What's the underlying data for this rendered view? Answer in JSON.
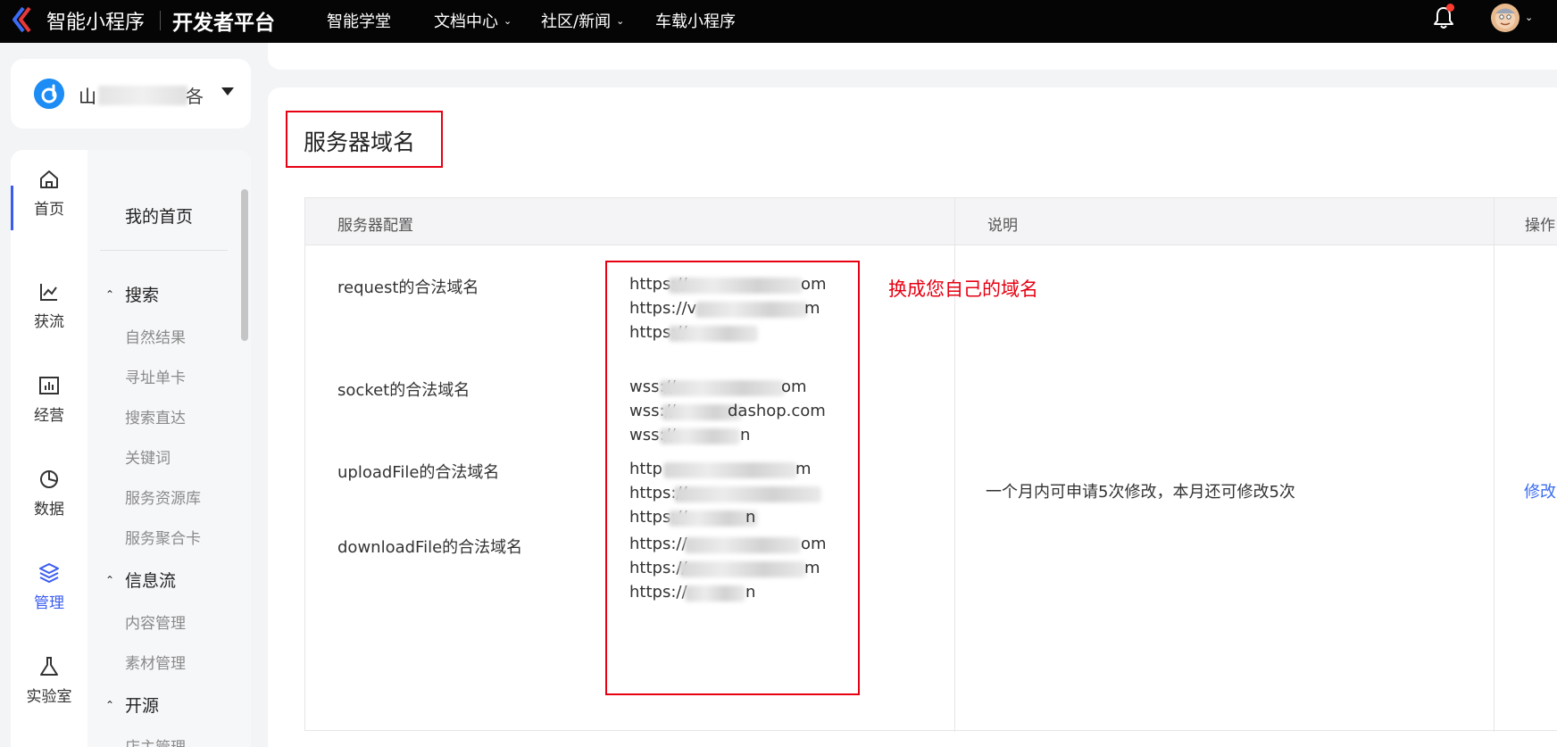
{
  "topbar": {
    "brand": "智能小程序",
    "platform": "开发者平台",
    "nav": [
      {
        "label": "智能学堂",
        "has_dropdown": false
      },
      {
        "label": "文档中心",
        "has_dropdown": true
      },
      {
        "label": "社区/新闻",
        "has_dropdown": true
      },
      {
        "label": "车载小程序",
        "has_dropdown": false
      }
    ],
    "icons": {
      "logo": "chevron-logo-icon",
      "notification": "bell-icon",
      "avatar": "user-avatar"
    },
    "notification_dot_color": "#ff3b30"
  },
  "app_selector": {
    "name_prefix": "山",
    "name_suffix": "各"
  },
  "rail": {
    "items": [
      {
        "label": "首页",
        "icon": "home-icon",
        "active": false
      },
      {
        "label": "获流",
        "icon": "line-chart-icon",
        "active": false
      },
      {
        "label": "经营",
        "icon": "bar-chart-icon",
        "active": false
      },
      {
        "label": "数据",
        "icon": "pie-chart-icon",
        "active": false
      },
      {
        "label": "管理",
        "icon": "layers-icon",
        "active": true
      },
      {
        "label": "实验室",
        "icon": "flask-icon",
        "active": false
      }
    ],
    "accent_color": "#3a5cf0"
  },
  "submenu": {
    "home": "我的首页",
    "groups": [
      {
        "label": "搜索",
        "items": [
          "自然结果",
          "寻址单卡",
          "搜索直达",
          "关键词",
          "服务资源库",
          "服务聚合卡"
        ]
      },
      {
        "label": "信息流",
        "items": [
          "内容管理",
          "素材管理"
        ]
      },
      {
        "label": "开源",
        "items": [
          "店主管理"
        ]
      }
    ]
  },
  "page": {
    "title": "服务器域名",
    "table": {
      "headers": [
        "服务器配置",
        "说明",
        "操作"
      ],
      "rows": [
        {
          "label": "request的合法域名",
          "domains": [
            "https://",
            "https://v",
            "https://"
          ]
        },
        {
          "label": "socket的合法域名",
          "domains": [
            "wss://",
            "wss://",
            "wss://"
          ]
        },
        {
          "label": "uploadFile的合法域名",
          "domains": [
            "http",
            "https://",
            "https://"
          ]
        },
        {
          "label": "downloadFile的合法域名",
          "domains": [
            "https://",
            "https://",
            "https://"
          ]
        }
      ],
      "domain_tails": [
        [
          "om",
          "m",
          ""
        ],
        [
          "om",
          "dashop.com",
          "n"
        ],
        [
          "m",
          "",
          "n"
        ],
        [
          "om",
          "m",
          "n"
        ]
      ],
      "description": "一个月内可申请5次修改，本月还可修改5次",
      "operation": "修改"
    },
    "annotation": "换成您自己的域名",
    "annotation_color": "#e60012"
  }
}
